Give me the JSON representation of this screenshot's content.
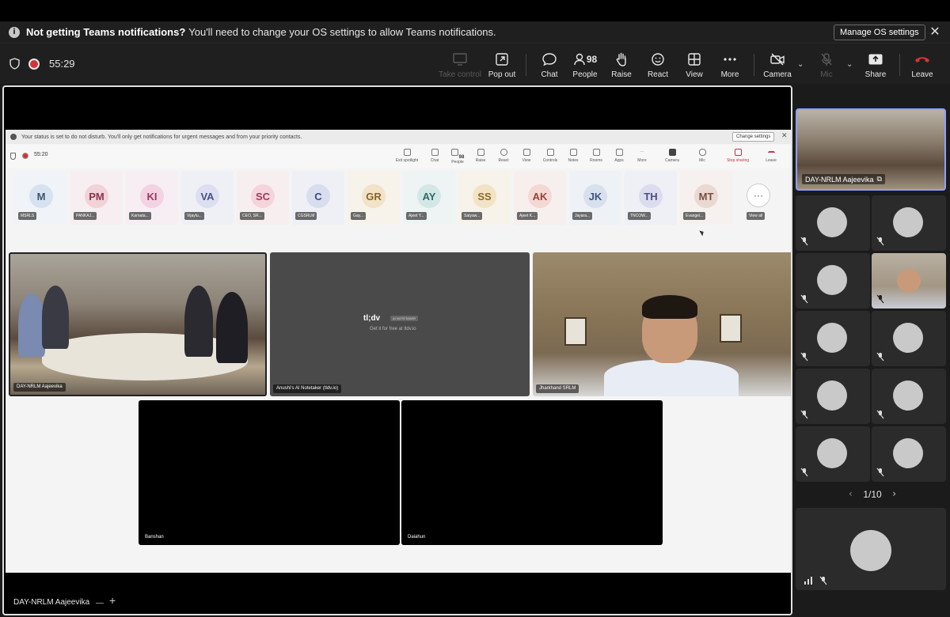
{
  "banner": {
    "title": "Not getting Teams notifications?",
    "message": "You'll need to change your OS settings to allow Teams notifications.",
    "manage_label": "Manage OS settings",
    "close_label": "✕"
  },
  "meeting": {
    "timer": "55:29"
  },
  "toolbar": {
    "take_control": "Take control",
    "pop_out": "Pop out",
    "chat": "Chat",
    "people": "People",
    "people_count": "98",
    "raise": "Raise",
    "react": "React",
    "view": "View",
    "more": "More",
    "camera": "Camera",
    "mic": "Mic",
    "share": "Share",
    "leave": "Leave"
  },
  "shared": {
    "banner_text": "Your status is set to do not disturb. You'll only get notifications for urgent messages and from your priority contacts.",
    "change_settings": "Change settings",
    "timer": "55:20",
    "toolbar": {
      "exit_spotlight": "Exit spotlight",
      "chat": "Chat",
      "people": "People",
      "people_count": "98",
      "raise": "Raise",
      "react": "React",
      "view": "View",
      "controls": "Controls",
      "notes": "Notes",
      "rooms": "Rooms",
      "apps": "Apps",
      "more": "More",
      "camera": "Camera",
      "mic": "Mic",
      "stop_sharing": "Stop sharing",
      "leave": "Leave"
    },
    "participants": [
      {
        "initials": "M",
        "name": "MSRLS"
      },
      {
        "initials": "PM",
        "name": "PANKAJ..."
      },
      {
        "initials": "KI",
        "name": "Karnata..."
      },
      {
        "initials": "VA",
        "name": "Vijaylu..."
      },
      {
        "initials": "SC",
        "name": "CEO, SR..."
      },
      {
        "initials": "C",
        "name": "CGSRLM"
      },
      {
        "initials": "GR",
        "name": "Gay..."
      },
      {
        "initials": "AY",
        "name": "Ajeet Y..."
      },
      {
        "initials": "SS",
        "name": "Satyaw..."
      },
      {
        "initials": "AK",
        "name": "Ajeet K..."
      },
      {
        "initials": "JK",
        "name": "Jayara..."
      },
      {
        "initials": "TH",
        "name": "TNCOW..."
      },
      {
        "initials": "MT",
        "name": "Evangel..."
      }
    ],
    "view_all": "View all",
    "videos": {
      "v1": "DAY-NRLM Aajeevika",
      "v2": "Anushi's AI Notetaker (tldv.io)",
      "v3": "Jharkhand SRLM",
      "v4": "Banshan",
      "v5": "Daiahun"
    },
    "tldv_logo": "tl;dv",
    "tldv_badge": "AI NOTETAKER",
    "tldv_sub": "Get it for free at tldv.io"
  },
  "stage": {
    "label": "DAY-NRLM Aajeevika"
  },
  "side": {
    "featured_name": "DAY-NRLM Aajeevika",
    "pager": "1/10"
  },
  "colors": {
    "accent": "#8ea0ff",
    "leave_red": "#d13438"
  }
}
